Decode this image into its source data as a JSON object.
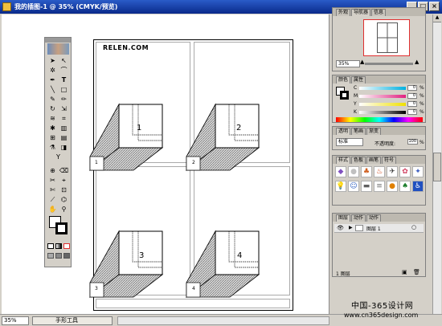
{
  "window": {
    "title": "我的插图-1 @ 35% (CMYK/预览)",
    "min_label": "_",
    "max_label": "□",
    "close_label": "×"
  },
  "canvas": {
    "logo": "RELEN.COM",
    "page_numbers": [
      "1",
      "2",
      "3",
      "4"
    ]
  },
  "status": {
    "zoom": "35%",
    "tool_label": "手形工具"
  },
  "navigator": {
    "tabs": [
      "外观",
      "导航器",
      "信息"
    ],
    "zoom": "35%"
  },
  "color": {
    "tabs": [
      "颜色",
      "属性"
    ],
    "channels": [
      "C",
      "M",
      "Y",
      "K"
    ],
    "values": [
      "0",
      "0",
      "0",
      "0"
    ],
    "unit": "%"
  },
  "transparency": {
    "tabs": [
      "透明",
      "笔画",
      "渐变"
    ],
    "mode": "标准",
    "opacity_label": "不透明度:",
    "opacity_value": "100",
    "unit": "%"
  },
  "styles": {
    "tabs": [
      "样式",
      "色板",
      "画笔",
      "符号"
    ]
  },
  "layers": {
    "tabs": [
      "图层",
      "动作",
      "动作"
    ],
    "layer_name": "图层 1",
    "footer": "1 图层"
  },
  "watermark": {
    "line1": "中国-365设计网",
    "line2": "www.cn365design.com"
  },
  "icons": {
    "canvas_bg": "#ffffff",
    "titlebar": "#1a45b0",
    "accent_red": "#e03030"
  }
}
